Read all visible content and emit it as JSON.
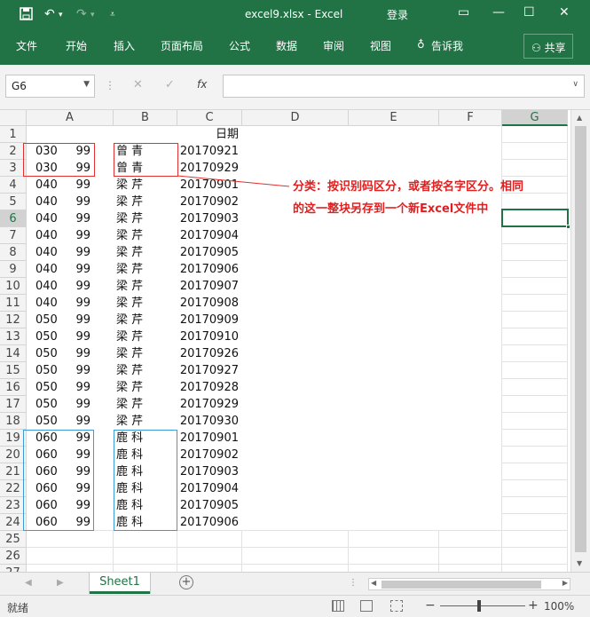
{
  "titlebar": {
    "title": "excel9.xlsx  -  Excel",
    "login": "登录",
    "save_icon": "save-icon",
    "undo_icon": "undo-icon",
    "redo_icon": "redo-icon",
    "customize_icon": "customize-icon"
  },
  "menu": {
    "items": [
      "文件",
      "开始",
      "插入",
      "页面布局",
      "公式",
      "数据",
      "审阅",
      "视图"
    ],
    "tell": "告诉我",
    "share": "共享"
  },
  "formula_bar": {
    "name_box": "G6",
    "cancel": "✕",
    "enter": "✓",
    "fx": "fx",
    "value": ""
  },
  "columns": [
    "A",
    "B",
    "C",
    "D",
    "E",
    "F",
    "G"
  ],
  "selected_column": "G",
  "selected_row": 6,
  "rows": [
    {
      "n": "1",
      "a": "",
      "b": "",
      "c": "日期"
    },
    {
      "n": "2",
      "a": "030",
      "a2": "99",
      "b": "曾  青",
      "c": "20170921"
    },
    {
      "n": "3",
      "a": "030",
      "a2": "99",
      "b": "曾  青",
      "c": "20170929"
    },
    {
      "n": "4",
      "a": "040",
      "a2": "99",
      "b": "梁  芹",
      "c": "20170901"
    },
    {
      "n": "5",
      "a": "040",
      "a2": "99",
      "b": "梁  芹",
      "c": "20170902"
    },
    {
      "n": "6",
      "a": "040",
      "a2": "99",
      "b": "梁  芹",
      "c": "20170903"
    },
    {
      "n": "7",
      "a": "040",
      "a2": "99",
      "b": "梁  芹",
      "c": "20170904"
    },
    {
      "n": "8",
      "a": "040",
      "a2": "99",
      "b": "梁  芹",
      "c": "20170905"
    },
    {
      "n": "9",
      "a": "040",
      "a2": "99",
      "b": "梁  芹",
      "c": "20170906"
    },
    {
      "n": "10",
      "a": "040",
      "a2": "99",
      "b": "梁  芹",
      "c": "20170907"
    },
    {
      "n": "11",
      "a": "040",
      "a2": "99",
      "b": "梁  芹",
      "c": "20170908"
    },
    {
      "n": "12",
      "a": "050",
      "a2": "99",
      "b": "梁  芹",
      "c": "20170909"
    },
    {
      "n": "13",
      "a": "050",
      "a2": "99",
      "b": "梁  芹",
      "c": "20170910"
    },
    {
      "n": "14",
      "a": "050",
      "a2": "99",
      "b": "梁  芹",
      "c": "20170926"
    },
    {
      "n": "15",
      "a": "050",
      "a2": "99",
      "b": "梁  芹",
      "c": "20170927"
    },
    {
      "n": "16",
      "a": "050",
      "a2": "99",
      "b": "梁  芹",
      "c": "20170928"
    },
    {
      "n": "17",
      "a": "050",
      "a2": "99",
      "b": "梁  芹",
      "c": "20170929"
    },
    {
      "n": "18",
      "a": "050",
      "a2": "99",
      "b": "梁  芹",
      "c": "20170930"
    },
    {
      "n": "19",
      "a": "060",
      "a2": "99",
      "b": "鹿  科",
      "c": "20170901"
    },
    {
      "n": "20",
      "a": "060",
      "a2": "99",
      "b": "鹿  科",
      "c": "20170902"
    },
    {
      "n": "21",
      "a": "060",
      "a2": "99",
      "b": "鹿  科",
      "c": "20170903"
    },
    {
      "n": "22",
      "a": "060",
      "a2": "99",
      "b": "鹿  科",
      "c": "20170904"
    },
    {
      "n": "23",
      "a": "060",
      "a2": "99",
      "b": "鹿  科",
      "c": "20170905"
    },
    {
      "n": "24",
      "a": "060",
      "a2": "99",
      "b": "鹿  科",
      "c": "20170906"
    },
    {
      "n": "25",
      "a": "",
      "b": "",
      "c": ""
    },
    {
      "n": "26",
      "a": "",
      "b": "",
      "c": ""
    },
    {
      "n": "27",
      "a": "",
      "b": "",
      "c": ""
    }
  ],
  "annotation": "分类：按识别码区分，或者按名字区分。相同的这一整块另存到一个新Excel文件中",
  "sheet_tab": "Sheet1",
  "status": {
    "ready": "就绪",
    "zoom": "100%"
  },
  "colors": {
    "accent": "#217346",
    "annotation": "#e02020",
    "red_box": "#e03030",
    "blue_box": "#3a9bd8"
  }
}
